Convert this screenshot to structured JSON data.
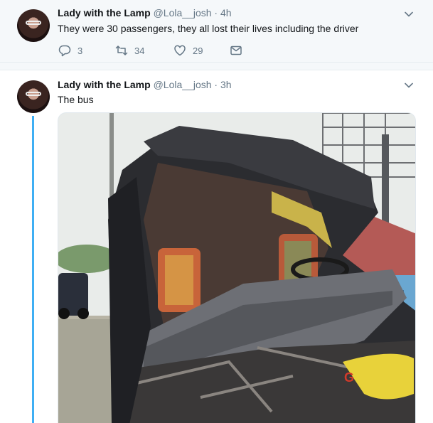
{
  "tweets": [
    {
      "name": "Lady with the Lamp",
      "handle": "@Lola__josh",
      "separator": "·",
      "time": "4h",
      "text": "They were 30 passengers, they all lost their lives including the driver",
      "actions": {
        "replies": "3",
        "retweets": "34",
        "likes": "29"
      },
      "icons": [
        "reply-icon",
        "retweet-icon",
        "heart-icon",
        "direct-message-icon",
        "chevron-down-icon"
      ]
    },
    {
      "name": "Lady with the Lamp",
      "handle": "@Lola__josh",
      "separator": "·",
      "time": "3h",
      "text": "The bus",
      "media": {
        "type": "photo",
        "subject": "wrecked bus"
      },
      "icons": [
        "chevron-down-icon"
      ]
    }
  ],
  "colors": {
    "accent": "#1da1f2",
    "text_primary": "#14171a",
    "text_secondary": "#657786",
    "background_alt": "#f5f8fa",
    "border": "#e6ecf0"
  }
}
